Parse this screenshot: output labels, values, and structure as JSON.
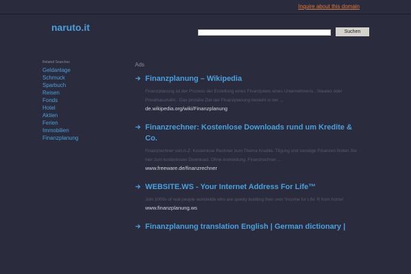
{
  "header": {
    "inquire_link": "Inquire about this domain",
    "domain": "naruto.it"
  },
  "search": {
    "value": "",
    "placeholder": "",
    "button_label": "Suchen"
  },
  "sidebar": {
    "heading": "Related Searches",
    "items": [
      {
        "label": "Geldanlage"
      },
      {
        "label": "Schmuck"
      },
      {
        "label": "Sparbuch"
      },
      {
        "label": "Reisen"
      },
      {
        "label": "Fonds"
      },
      {
        "label": "Hotel"
      },
      {
        "label": "Aktien"
      },
      {
        "label": "Ferien"
      },
      {
        "label": "Immobilien"
      },
      {
        "label": "Finanzplanung"
      }
    ]
  },
  "main": {
    "ads_label": "Ads",
    "ads": [
      {
        "title": "Finanzplanung – Wikipedia",
        "description": "Finanzplanung ist der Prozess der Erstellung eines Finanzplans eines Unternehmens , Staates oder Privathaushalts . Das primäre Ziel der Finanzplanung besteht in der ...",
        "url": "de.wikipedia.org/wiki/Finanzplanung"
      },
      {
        "title": "Finanzrechner: Kostenlose Downloads rund um Kredite & Co.",
        "description": "Finanzrechner von A-Z: Kostenlose Rechner zum Thema Kredite, Tilgung und sonstige Finanzen finden Sie hier zum kostenlosen Download. Ohne Anmeldung. Finanzrechner ...",
        "url": "www.freeware.de/finanzrechner"
      },
      {
        "title": "WEBSITE.WS - Your Internet Address For Life™",
        "description": "Join 1000s of real people worldwide who are quietly building their own 'Income for Life' R from home!",
        "url": "www.finanzplanung.ws"
      },
      {
        "title": "Finanzplanung translation English | German dictionary |",
        "description": "",
        "url": ""
      }
    ]
  },
  "colors": {
    "background": "#2a2b3d",
    "link": "#4aa0dc",
    "inquire": "#e07b3a",
    "description": "#5a5b6c",
    "url": "#d8d8de"
  },
  "icons": {
    "ad_arrow": "arrow-right-icon"
  }
}
